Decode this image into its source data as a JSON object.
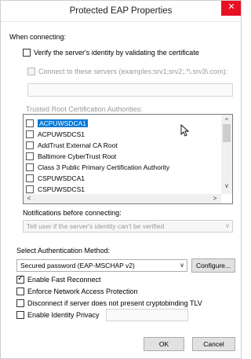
{
  "window": {
    "title": "Protected EAP Properties",
    "close_glyph": "✕"
  },
  "connecting": {
    "heading": "When connecting:",
    "verify_label": "Verify the server's identity by validating the certificate",
    "verify_checked": false,
    "connect_servers_label": "Connect to these servers (examples:srv1;srv2;.*\\.srv3\\.com):",
    "connect_servers_value": "",
    "trusted_roots_heading": "Trusted Root Certification Authorities:",
    "trusted_roots": [
      {
        "name": "ACPUWSDCA1",
        "checked": false,
        "selected": true
      },
      {
        "name": "ACPUWSDCS1",
        "checked": false,
        "selected": false
      },
      {
        "name": "AddTrust External CA Root",
        "checked": false,
        "selected": false
      },
      {
        "name": "Baltimore CyberTrust Root",
        "checked": false,
        "selected": false
      },
      {
        "name": "Class 3 Public Primary Certification Authority",
        "checked": false,
        "selected": false
      },
      {
        "name": "CSPUWSDCA1",
        "checked": false,
        "selected": false
      },
      {
        "name": "CSPUWSDCS1",
        "checked": false,
        "selected": false
      }
    ],
    "scroll_up": "^",
    "scroll_down": "v",
    "scroll_left": "<",
    "scroll_right": ">"
  },
  "notifications": {
    "heading": "Notifications before connecting:",
    "selected": "Tell user if the server's identity can't be verified",
    "arrow": "v"
  },
  "auth": {
    "heading": "Select Authentication Method:",
    "selected": "Secured password (EAP-MSCHAP v2)",
    "arrow": "v",
    "configure_label": "Configure..."
  },
  "options": [
    {
      "label": "Enable Fast Reconnect",
      "checked": true
    },
    {
      "label": "Enforce Network Access Protection",
      "checked": false
    },
    {
      "label": "Disconnect if server does not present cryptobinding TLV",
      "checked": false
    },
    {
      "label": "Enable Identity Privacy",
      "checked": false
    }
  ],
  "identity_privacy_value": "",
  "footer": {
    "ok_label": "OK",
    "cancel_label": "Cancel"
  }
}
